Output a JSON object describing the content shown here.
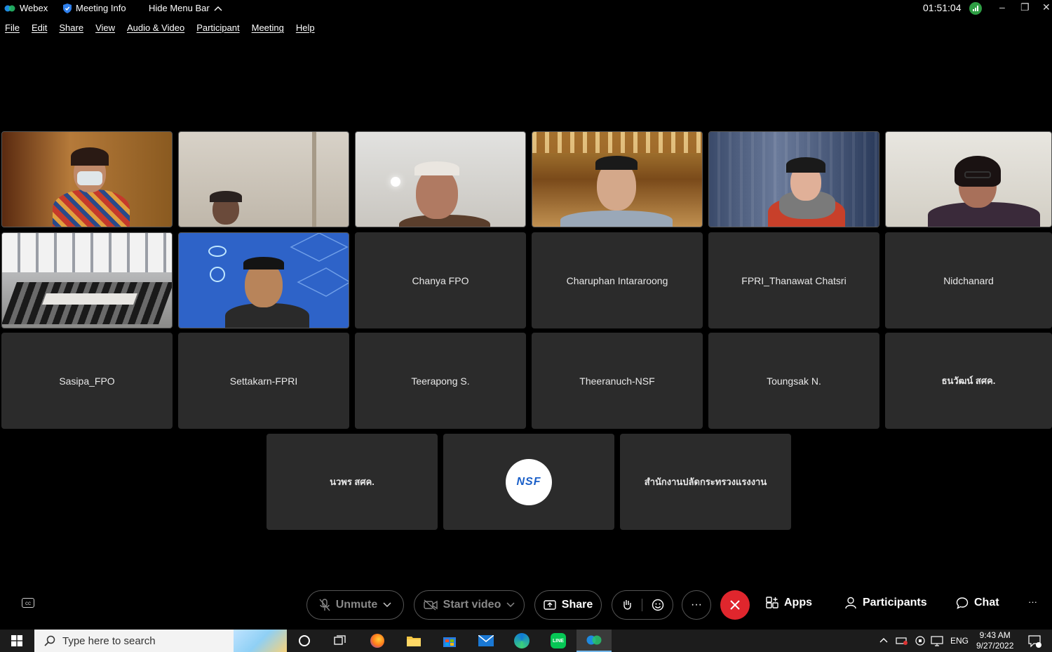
{
  "titlebar": {
    "app_name": "Webex",
    "meeting_info": "Meeting Info",
    "hide_menu": "Hide Menu Bar",
    "timer": "01:51:04",
    "minimize": "–",
    "restore": "❐",
    "close": "✕"
  },
  "menu": [
    "File",
    "Edit",
    "Share",
    "View",
    "Audio & Video",
    "Participant",
    "Meeting",
    "Help"
  ],
  "participants": {
    "row2": [
      "Chanya FPO",
      "Charuphan Intararoong",
      "FPRI_Thanawat Chatsri",
      "Nidchanard"
    ],
    "row3": [
      "Sasipa_FPO",
      "Settakarn-FPRI",
      "Teerapong S.",
      "Theeranuch-NSF",
      "Toungsak N.",
      "ธนวัฒน์ สศค."
    ],
    "row4": [
      "นวพร สศค.",
      "",
      "สำนักงานปลัดกระทรวงแรงงาน"
    ],
    "logo_text": "NSF"
  },
  "controls": {
    "unmute": "Unmute",
    "start_video": "Start video",
    "share": "Share",
    "more": "···",
    "apps": "Apps",
    "participants": "Participants",
    "chat": "Chat",
    "overflow": "···"
  },
  "taskbar": {
    "search_placeholder": "Type here to search",
    "lang": "ENG",
    "time": "9:43 AM",
    "date": "9/27/2022"
  },
  "colors": {
    "end_call": "#e0262d",
    "signal": "#2e9e44",
    "tile_bg": "#2b2b2b"
  }
}
